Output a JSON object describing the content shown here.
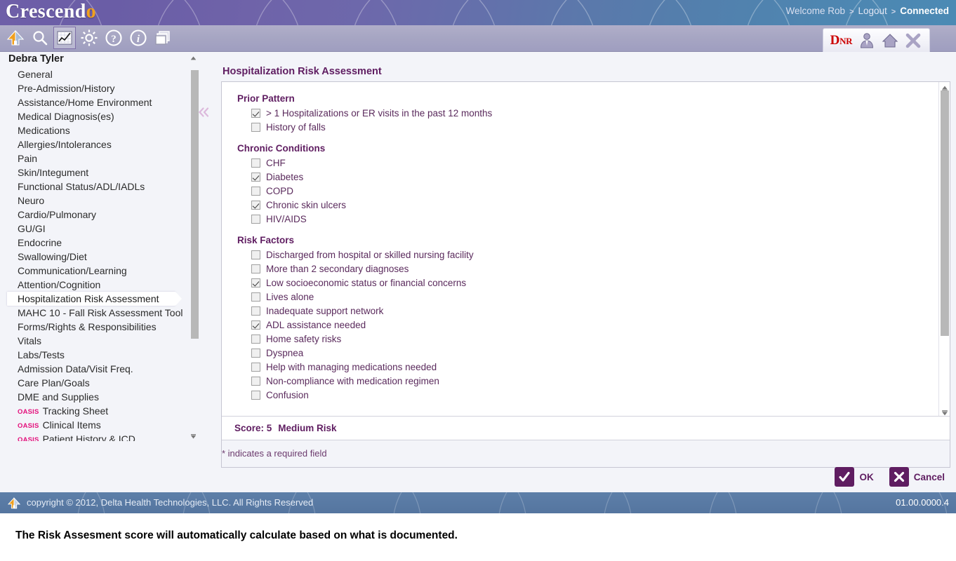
{
  "header": {
    "logo_text": "Crescend",
    "logo_accent_letter": "o",
    "welcome": "Welcome Rob",
    "sep1": ">",
    "logout": "Logout",
    "sep2": ">",
    "status": "Connected",
    "brand_purple": "#5f1d61",
    "accent_orange": "#f0a01e"
  },
  "toolbar": {
    "icons": [
      {
        "name": "home-icon",
        "title": "Home"
      },
      {
        "name": "search-icon",
        "title": "Search"
      },
      {
        "name": "chart-icon",
        "title": "Reports"
      },
      {
        "name": "gear-icon",
        "title": "Settings"
      },
      {
        "name": "help-icon",
        "title": "Help"
      },
      {
        "name": "info-icon",
        "title": "Info"
      },
      {
        "name": "windows-icon",
        "title": "Windows"
      }
    ],
    "patient_tab": {
      "dnr_big": "D",
      "dnr_small": "NR",
      "person_icon": "person-icon",
      "home_icon": "home-icon",
      "close_icon": "close-icon"
    }
  },
  "sidebar": {
    "patient_name": "Debra Tyler",
    "collapse_label": "«",
    "items": [
      {
        "label": "General",
        "oasis": false,
        "selected": false
      },
      {
        "label": "Pre-Admission/History",
        "oasis": false,
        "selected": false
      },
      {
        "label": "Assistance/Home Environment",
        "oasis": false,
        "selected": false
      },
      {
        "label": "Medical Diagnosis(es)",
        "oasis": false,
        "selected": false
      },
      {
        "label": "Medications",
        "oasis": false,
        "selected": false
      },
      {
        "label": "Allergies/Intolerances",
        "oasis": false,
        "selected": false
      },
      {
        "label": "Pain",
        "oasis": false,
        "selected": false
      },
      {
        "label": "Skin/Integument",
        "oasis": false,
        "selected": false
      },
      {
        "label": "Functional Status/ADL/IADLs",
        "oasis": false,
        "selected": false
      },
      {
        "label": "Neuro",
        "oasis": false,
        "selected": false
      },
      {
        "label": "Cardio/Pulmonary",
        "oasis": false,
        "selected": false
      },
      {
        "label": "GU/GI",
        "oasis": false,
        "selected": false
      },
      {
        "label": "Endocrine",
        "oasis": false,
        "selected": false
      },
      {
        "label": "Swallowing/Diet",
        "oasis": false,
        "selected": false
      },
      {
        "label": "Communication/Learning",
        "oasis": false,
        "selected": false
      },
      {
        "label": "Attention/Cognition",
        "oasis": false,
        "selected": false
      },
      {
        "label": "Hospitalization Risk Assessment",
        "oasis": false,
        "selected": true
      },
      {
        "label": "MAHC 10 - Fall Risk Assessment Tool",
        "oasis": false,
        "selected": false
      },
      {
        "label": "Forms/Rights & Responsibilities",
        "oasis": false,
        "selected": false
      },
      {
        "label": "Vitals",
        "oasis": false,
        "selected": false
      },
      {
        "label": "Labs/Tests",
        "oasis": false,
        "selected": false
      },
      {
        "label": "Admission Data/Visit Freq.",
        "oasis": false,
        "selected": false
      },
      {
        "label": "Care Plan/Goals",
        "oasis": false,
        "selected": false
      },
      {
        "label": "DME and Supplies",
        "oasis": false,
        "selected": false
      },
      {
        "label": "Tracking Sheet",
        "oasis": true,
        "selected": false
      },
      {
        "label": "Clinical Items",
        "oasis": true,
        "selected": false
      },
      {
        "label": "Patient History & ICD",
        "oasis": true,
        "selected": false
      }
    ],
    "oasis_tag": "OASIS"
  },
  "form": {
    "title": "Hospitalization Risk Assessment",
    "groups": [
      {
        "title": "Prior Pattern",
        "items": [
          {
            "label": "> 1 Hospitalizations or ER visits in the past 12 months",
            "checked": true
          },
          {
            "label": "History of falls",
            "checked": false
          }
        ]
      },
      {
        "title": "Chronic Conditions",
        "items": [
          {
            "label": "CHF",
            "checked": false
          },
          {
            "label": "Diabetes",
            "checked": true
          },
          {
            "label": "COPD",
            "checked": false
          },
          {
            "label": "Chronic skin ulcers",
            "checked": true
          },
          {
            "label": "HIV/AIDS",
            "checked": false
          }
        ]
      },
      {
        "title": "Risk Factors",
        "items": [
          {
            "label": "Discharged from hospital or skilled nursing facility",
            "checked": false
          },
          {
            "label": "More than 2 secondary diagnoses",
            "checked": false
          },
          {
            "label": "Low socioeconomic status or financial concerns",
            "checked": true
          },
          {
            "label": "Lives alone",
            "checked": false
          },
          {
            "label": "Inadequate support network",
            "checked": false
          },
          {
            "label": "ADL assistance needed",
            "checked": true
          },
          {
            "label": "Home safety risks",
            "checked": false
          },
          {
            "label": "Dyspnea",
            "checked": false
          },
          {
            "label": "Help with managing medications needed",
            "checked": false
          },
          {
            "label": "Non-compliance with medication regimen",
            "checked": false
          },
          {
            "label": "Confusion",
            "checked": false
          }
        ]
      }
    ],
    "score_label": "Score: 5",
    "risk_level": "Medium Risk",
    "required_note": "* indicates a required field"
  },
  "actions": {
    "ok_label": "OK",
    "cancel_label": "Cancel"
  },
  "footer": {
    "copyright": "copyright © 2012, Delta Health Technologies, LLC. All Rights Reserved",
    "version": "01.00.0000.4"
  },
  "caption": {
    "text": "The Risk Assesment score will automatically calculate based on what is documented."
  }
}
